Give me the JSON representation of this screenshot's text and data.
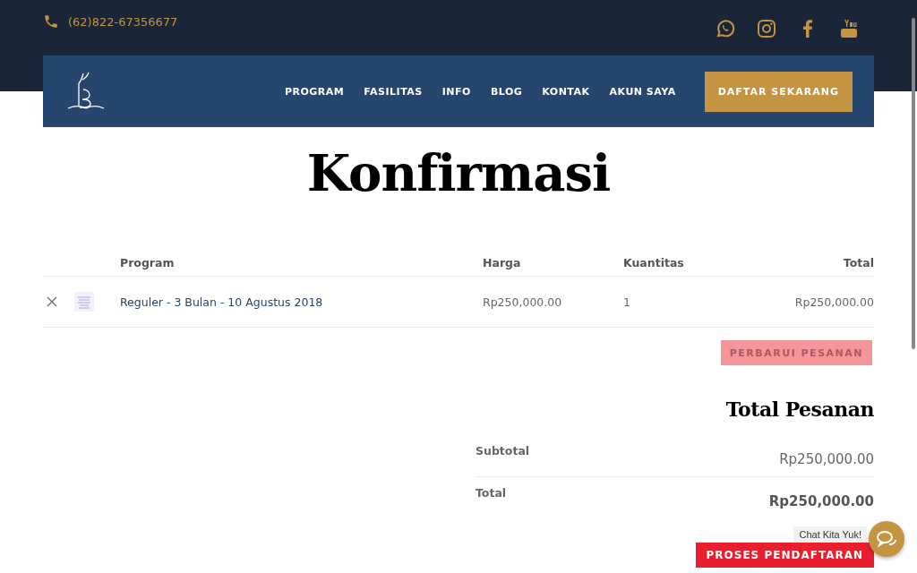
{
  "topbar": {
    "phone": "(62)822-67356677"
  },
  "nav": {
    "items": [
      "PROGRAM",
      "FASILITAS",
      "INFO",
      "BLOG",
      "KONTAK",
      "AKUN SAYA"
    ],
    "cta": "DAFTAR SEKARANG"
  },
  "page_title": "Konfirmasi",
  "cart": {
    "columns": [
      "Program",
      "Harga",
      "Kuantitas",
      "Total"
    ],
    "rows": [
      {
        "program": "Reguler - 3 Bulan - 10 Agustus 2018",
        "price": "Rp250,000.00",
        "quantity": "1",
        "total": "Rp250,000.00"
      }
    ],
    "update_button": {
      "label": "PERBARUI PESANAN",
      "disabled": true
    }
  },
  "totals": {
    "title": "Total Pesanan",
    "rows": [
      {
        "label": "Subtotal",
        "value": "Rp250,000.00",
        "kind": "plain"
      },
      {
        "label": "Total",
        "value": "Rp250,000.00",
        "kind": "strong"
      }
    ],
    "checkout": "PROSES PENDAFTARAN"
  },
  "chat": {
    "tooltip": "Chat Kita Yuk!"
  }
}
